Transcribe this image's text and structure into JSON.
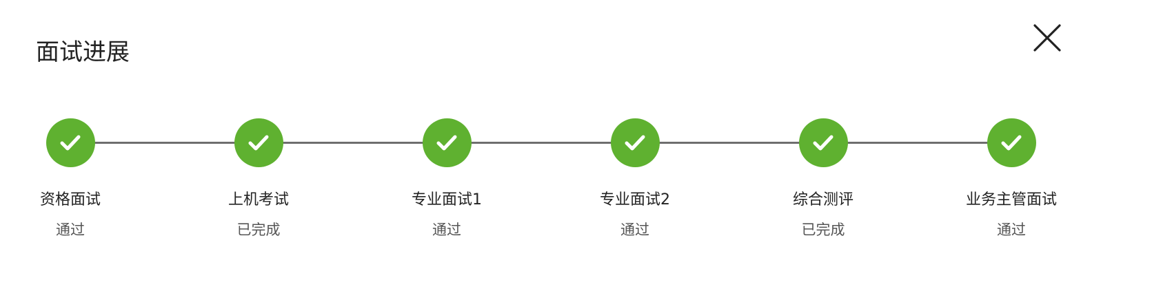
{
  "dialog": {
    "title": "面试进展",
    "close_icon": "close-icon"
  },
  "colors": {
    "complete": "#5fb130",
    "connector": "#6e6e6e",
    "title_text": "#222222",
    "status_text": "#555555"
  },
  "steps": [
    {
      "name": "资格面试",
      "status": "通过",
      "icon": "check-icon",
      "complete": true
    },
    {
      "name": "上机考试",
      "status": "已完成",
      "icon": "check-icon",
      "complete": true
    },
    {
      "name": "专业面试1",
      "status": "通过",
      "icon": "check-icon",
      "complete": true
    },
    {
      "name": "专业面试2",
      "status": "通过",
      "icon": "check-icon",
      "complete": true
    },
    {
      "name": "综合测评",
      "status": "已完成",
      "icon": "check-icon",
      "complete": true
    },
    {
      "name": "业务主管面试",
      "status": "通过",
      "icon": "check-icon",
      "complete": true
    }
  ]
}
